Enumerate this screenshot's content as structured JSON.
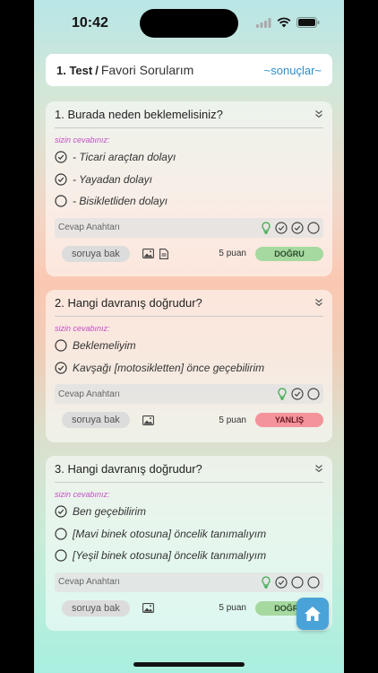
{
  "statusbar": {
    "time": "10:42"
  },
  "header": {
    "test_label": "1. Test",
    "separator": "/",
    "title": "Favori Sorularım",
    "results_link": "~sonuçlar~"
  },
  "common": {
    "your_answer_label": "sizin cevabınız:",
    "answer_key_label": "Cevap Anahtarı",
    "view_question_label": "soruya bak",
    "points_label": "5 puan"
  },
  "questions": [
    {
      "text": "1. Burada neden beklemelisiniz?",
      "options": [
        {
          "text": "- Ticari araçtan dolayı",
          "checked": true
        },
        {
          "text": "- Yayadan dolayı",
          "checked": true
        },
        {
          "text": "- Bisikletliden dolayı",
          "checked": false
        }
      ],
      "answer_key": [
        "checked",
        "checked",
        "empty"
      ],
      "icons": [
        "image-icon",
        "document-icon"
      ],
      "status": "DOĞRU",
      "status_type": "correct"
    },
    {
      "text": "2. Hangi davranış doğrudur?",
      "options": [
        {
          "text": "Beklemeliyim",
          "checked": false
        },
        {
          "text": "Kavşağı [motosikletten] önce geçebilirim",
          "checked": true
        }
      ],
      "answer_key": [
        "checked",
        "empty"
      ],
      "icons": [
        "image-icon"
      ],
      "status": "YANLIŞ",
      "status_type": "wrong"
    },
    {
      "text": "3. Hangi davranış doğrudur?",
      "options": [
        {
          "text": "Ben geçebilirim",
          "checked": true
        },
        {
          "text": "[Mavi binek otosuna] öncelik tanımalıyım",
          "checked": false
        },
        {
          "text": "[Yeşil binek otosuna] öncelik tanımalıyım",
          "checked": false
        }
      ],
      "answer_key": [
        "checked",
        "empty",
        "empty"
      ],
      "icons": [
        "image-icon"
      ],
      "status": "DOĞRU",
      "status_type": "correct"
    }
  ],
  "colors": {
    "accent": "#2f8dc8",
    "correct": "#a6d9a0",
    "wrong": "#f4939b",
    "hint": "#c24fc4",
    "fab": "#4aa3d8"
  }
}
